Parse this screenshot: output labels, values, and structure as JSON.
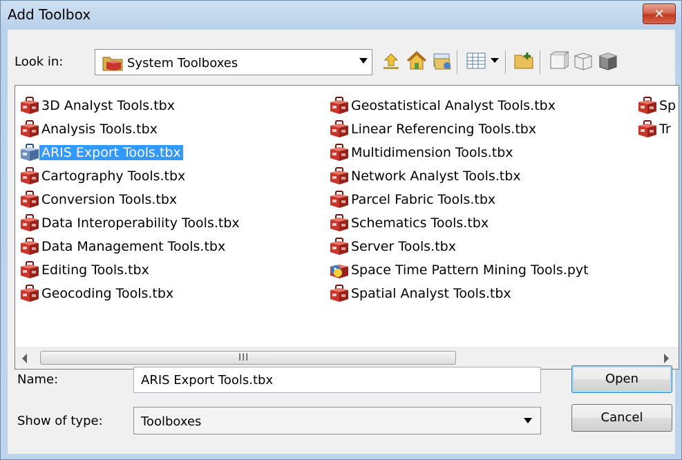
{
  "window": {
    "title": "Add Toolbox",
    "close_glyph": "✕"
  },
  "look_in": {
    "label": "Look in:",
    "value": "System Toolboxes",
    "icon": "toolbox-folder-icon"
  },
  "toolbar": [
    {
      "name": "up-one-level-icon"
    },
    {
      "name": "home-icon"
    },
    {
      "name": "connect-folder-icon"
    },
    {
      "name": "view-details-icon"
    },
    {
      "name": "view-dropdown-icon"
    },
    {
      "name": "new-folder-icon"
    },
    {
      "name": "new-geodatabase-icon"
    },
    {
      "name": "new-toolbox-icon"
    },
    {
      "name": "toolbox-icon"
    }
  ],
  "files": {
    "column1": [
      "3D Analyst Tools.tbx",
      "Analysis Tools.tbx",
      "ARIS Export Tools.tbx",
      "Cartography Tools.tbx",
      "Conversion Tools.tbx",
      "Data Interoperability Tools.tbx",
      "Data Management Tools.tbx",
      "Editing Tools.tbx",
      "Geocoding Tools.tbx"
    ],
    "column2": [
      "Geostatistical Analyst Tools.tbx",
      "Linear Referencing Tools.tbx",
      "Multidimension Tools.tbx",
      "Network Analyst Tools.tbx",
      "Parcel Fabric Tools.tbx",
      "Schematics Tools.tbx",
      "Server Tools.tbx",
      "Space Time Pattern Mining Tools.pyt",
      "Spatial Analyst Tools.tbx"
    ],
    "column3": [
      "Sp",
      "Tr"
    ],
    "selected": "ARIS Export Tools.tbx"
  },
  "scrollbar": {
    "grip": "III"
  },
  "name_field": {
    "label": "Name:",
    "value": "ARIS Export Tools.tbx"
  },
  "type_field": {
    "label": "Show of type:",
    "value": "Toolboxes"
  },
  "buttons": {
    "open": "Open",
    "cancel": "Cancel"
  },
  "colors": {
    "selection": "#3399ff",
    "toolbox_red": "#b3281e",
    "accent_blue": "#3c7fb1"
  }
}
